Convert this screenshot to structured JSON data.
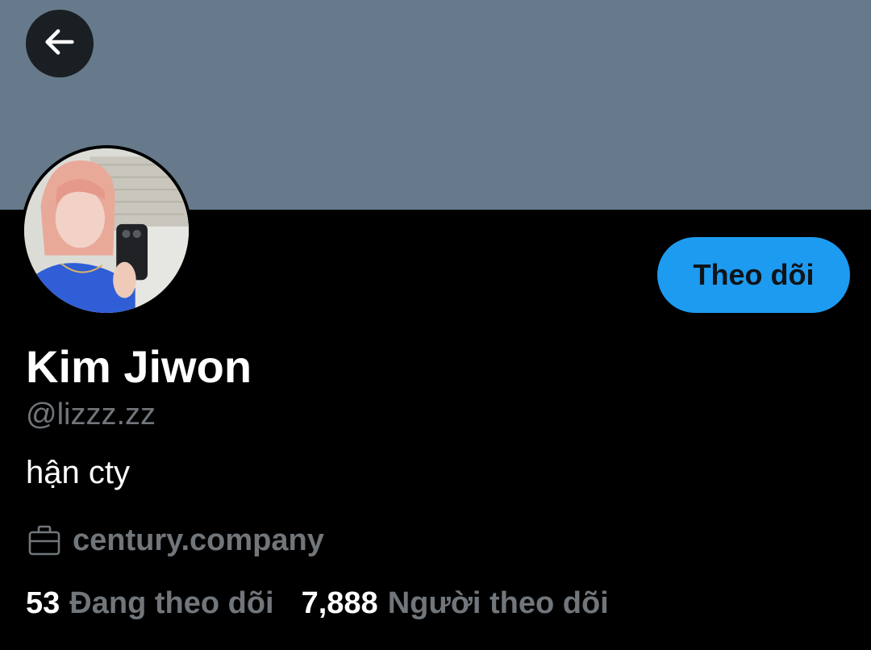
{
  "colors": {
    "banner": "#667a8b",
    "background": "#000000",
    "accent": "#1d9bf0",
    "secondary_text": "#71767b",
    "primary_text": "#ffffff",
    "follow_text": "#0f1419"
  },
  "header": {
    "back_icon": "arrow-left-icon"
  },
  "profile": {
    "follow_label": "Theo dõi",
    "display_name": "Kim Jiwon",
    "handle": "@lizzz.zz",
    "bio": "hận cty",
    "work": {
      "icon": "briefcase-icon",
      "label": "century.company"
    },
    "stats": {
      "following_count": "53",
      "following_label": "Đang theo dõi",
      "followers_count": "7,888",
      "followers_label": "Người theo dõi"
    }
  }
}
